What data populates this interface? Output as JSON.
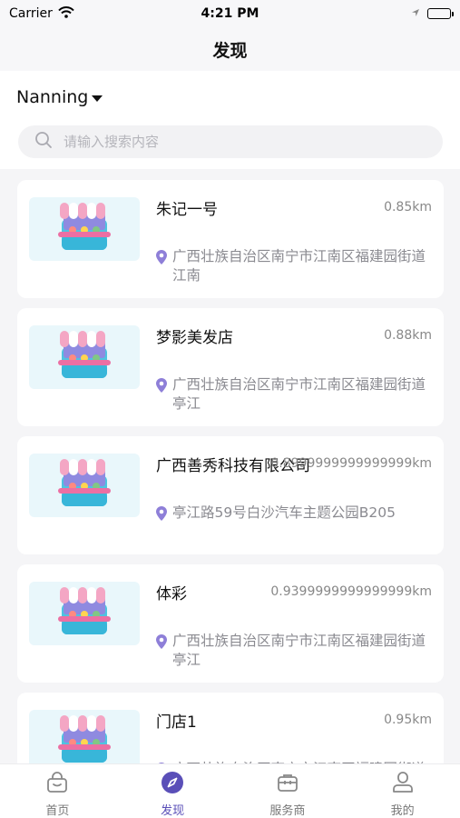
{
  "status_bar": {
    "carrier": "Carrier",
    "time": "4:21 PM"
  },
  "nav": {
    "title": "发现"
  },
  "city": "Nanning",
  "search": {
    "placeholder": "请输入搜索内容"
  },
  "shops": [
    {
      "name": "朱记一号",
      "distance": "0.85km",
      "address": "广西壮族自治区南宁市江南区福建园街道江南"
    },
    {
      "name": "梦影美发店",
      "distance": "0.88km",
      "address": "广西壮族自治区南宁市江南区福建园街道亭江"
    },
    {
      "name": "广西善秀科技有限公司",
      "distance": "0.8999999999999999km",
      "address": "亭江路59号白沙汽车主题公园B205"
    },
    {
      "name": "体彩",
      "distance": "0.9399999999999999km",
      "address": "广西壮族自治区南宁市江南区福建园街道亭江"
    },
    {
      "name": "门店1",
      "distance": "0.95km",
      "address": "广西壮族自治区南宁市江南区福建园街道亭江"
    }
  ],
  "tabs": [
    {
      "label": "首页",
      "icon": "shopping-bag-icon"
    },
    {
      "label": "发现",
      "icon": "compass-icon",
      "active": true
    },
    {
      "label": "服务商",
      "icon": "briefcase-icon"
    },
    {
      "label": "我的",
      "icon": "user-icon"
    }
  ],
  "colors": {
    "accent": "#5a4fb8",
    "pin": "#8e7fd8",
    "thumb_bg": "#e9f7fb"
  }
}
